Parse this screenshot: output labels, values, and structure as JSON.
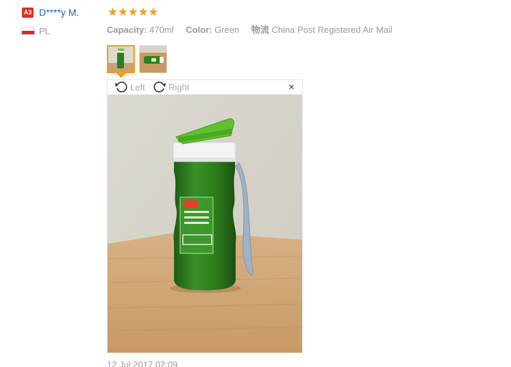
{
  "review": {
    "user": {
      "badge": "A3",
      "name": "D****y M.",
      "country": "PL"
    },
    "rating": {
      "stars": 5,
      "max": 5,
      "color": "#f59a1d"
    },
    "attributes": {
      "capacity_key": "Capacity:",
      "capacity_val": "470ml",
      "color_key": "Color:",
      "color_val": "Green",
      "shipping_key": "物流",
      "shipping_val": "China Post Registered Air Mail"
    },
    "viewer": {
      "rotate_left": "Left",
      "rotate_right": "Right",
      "close": "×"
    },
    "date": "12 Jul 2017 02:09"
  },
  "colors": {
    "link": "#1a64b8",
    "accent": "#f59a1d",
    "badge": "#e0301e",
    "muted": "#999999"
  },
  "icons": [
    "rotate-left-icon",
    "rotate-right-icon",
    "close-icon",
    "star-icon",
    "flag-pl-icon"
  ]
}
